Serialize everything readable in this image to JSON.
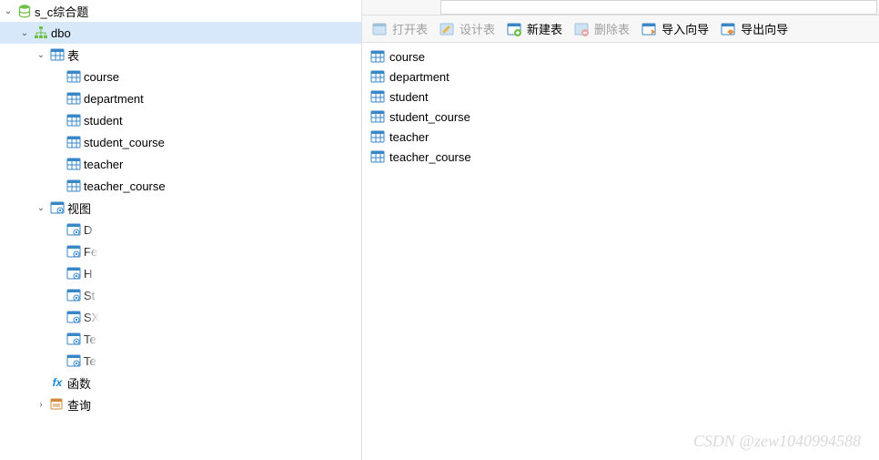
{
  "tree": {
    "database": "s_c综合题",
    "schema": "dbo",
    "tables_label": "表",
    "tables": [
      "course",
      "department",
      "student",
      "student_course",
      "teacher",
      "teacher_course"
    ],
    "views_label": "视图",
    "views": [
      "D",
      "Fe",
      "H",
      "St",
      "SX",
      "Te",
      "Te"
    ],
    "functions_label": "函数",
    "queries_label": "查询"
  },
  "toolbar": {
    "open_table": "打开表",
    "design_table": "设计表",
    "new_table": "新建表",
    "delete_table": "删除表",
    "import_wizard": "导入向导",
    "export_wizard": "导出向导"
  },
  "table_list": [
    "course",
    "department",
    "student",
    "student_course",
    "teacher",
    "teacher_course"
  ],
  "watermark": "CSDN @zew1040994588"
}
